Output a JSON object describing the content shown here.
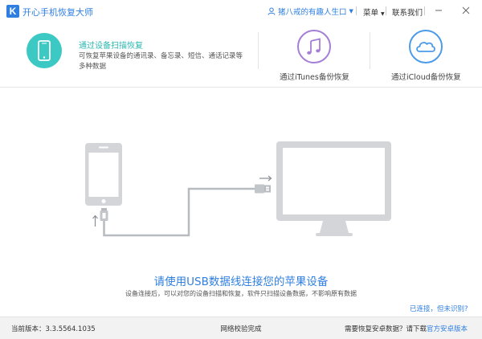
{
  "window": {
    "title": "开心手机恢复大师",
    "user_name": "猪八戒的有趣人生口",
    "menu_label": "菜单",
    "contact_label": "联系我们"
  },
  "modes": [
    {
      "title": "通过设备扫描恢复",
      "description": "可恢复苹果设备的通讯录、备忘录、短信、通话记录等多种数据",
      "active": true,
      "icon": "phone-icon",
      "color": "#3cc9c4"
    },
    {
      "title": "通过iTunes备份恢复",
      "active": false,
      "icon": "music-note-icon",
      "color": "#a57fd6"
    },
    {
      "title": "通过iCloud备份恢复",
      "active": false,
      "icon": "cloud-icon",
      "color": "#4c9be8"
    }
  ],
  "main": {
    "headline": "请使用USB数据线连接您的苹果设备",
    "subtext": "设备连接后，可以对您的设备扫描和恢复，软件只扫描设备数据，不影响原有数据",
    "help_link": "已连接，但未识别?"
  },
  "statusbar": {
    "version": "当前版本：3.3.5564.1035",
    "status": "网络校验完成",
    "android_prompt": "需要恢复安卓数据？请下载",
    "android_link": "官方安卓版本"
  },
  "colors": {
    "accent_blue": "#2f7fe0",
    "accent_teal": "#3cc9c4",
    "device_gray": "#d3d5d9",
    "cable_gray": "#b7babf"
  }
}
